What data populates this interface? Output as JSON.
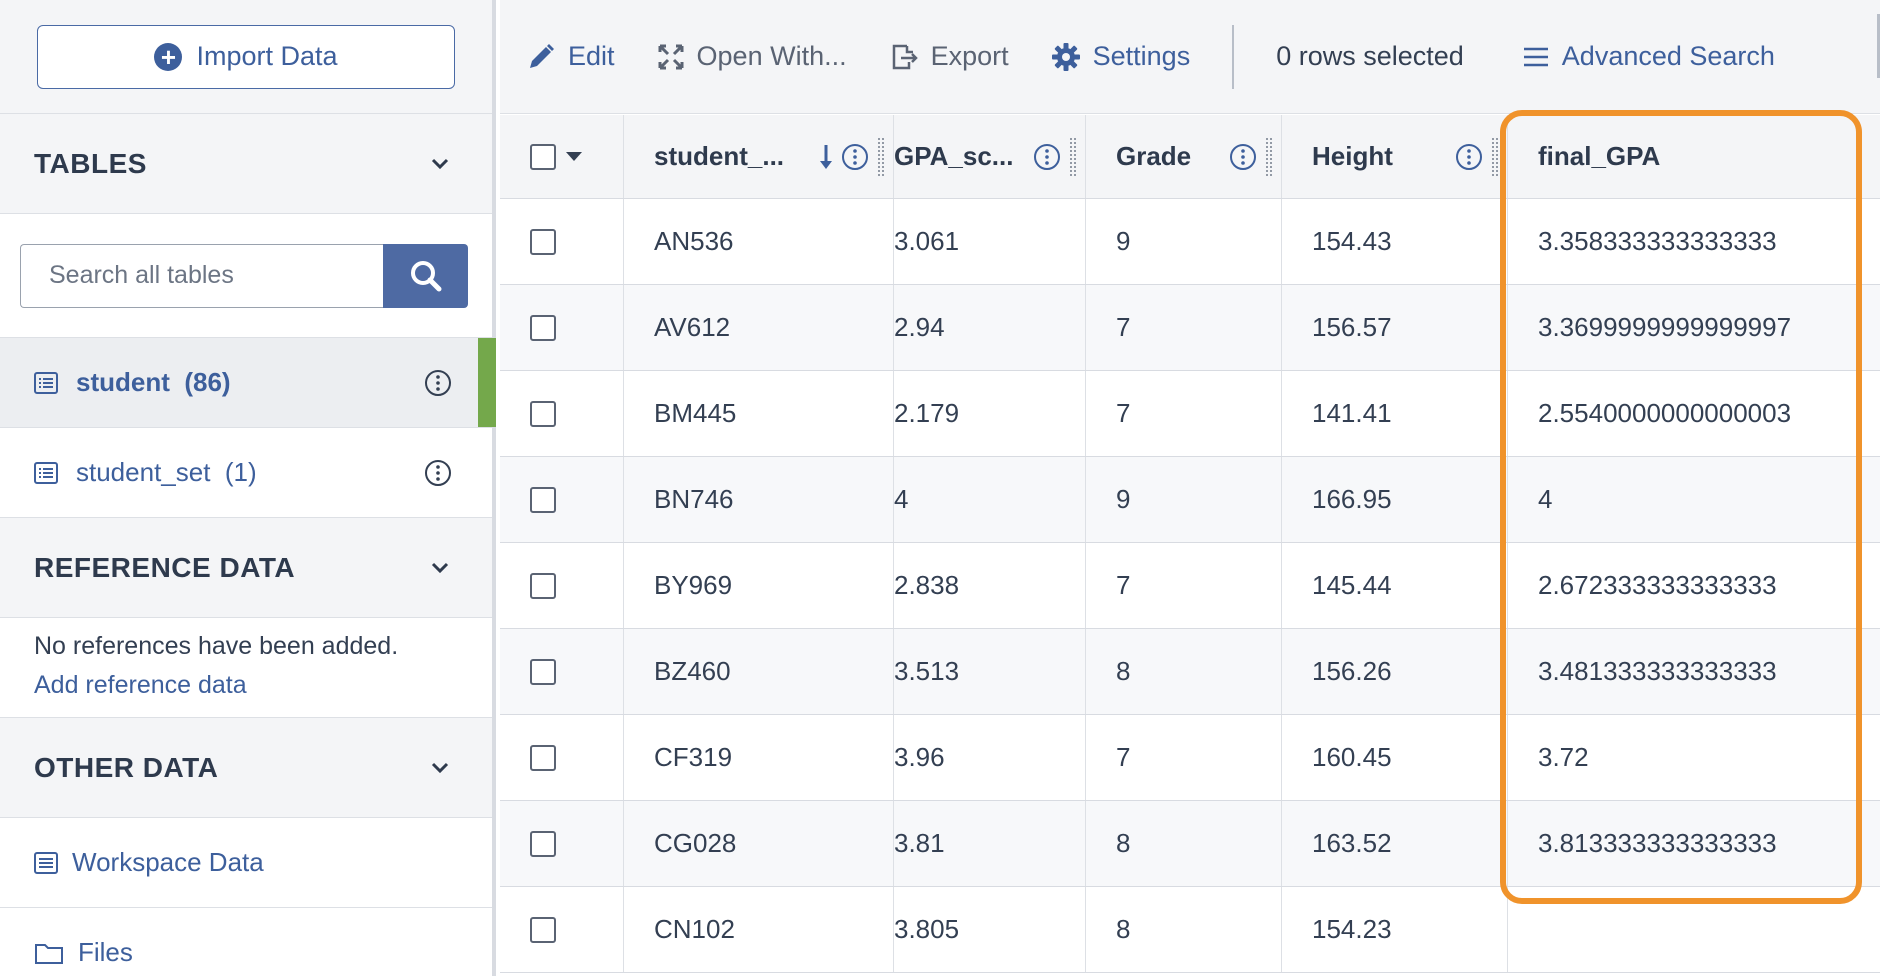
{
  "sidebar": {
    "import_label": "Import Data",
    "tables_title": "TABLES",
    "search_placeholder": "Search all tables",
    "tables": [
      {
        "name": "student",
        "count": "(86)"
      },
      {
        "name": "student_set",
        "count": "(1)"
      }
    ],
    "reference_title": "REFERENCE DATA",
    "reference_empty": "No references have been added.",
    "reference_add": "Add reference data",
    "other_title": "OTHER DATA",
    "other_items": [
      "Workspace Data",
      "Files"
    ]
  },
  "toolbar": {
    "edit": "Edit",
    "open_with": "Open With...",
    "export": "Export",
    "settings": "Settings",
    "rows_selected": "0 rows selected",
    "advanced_search": "Advanced Search"
  },
  "grid": {
    "columns": [
      "student_...",
      "GPA_sc...",
      "Grade",
      "Height",
      "final_GPA"
    ],
    "rows": [
      [
        "AN536",
        "3.061",
        "9",
        "154.43",
        "3.358333333333333"
      ],
      [
        "AV612",
        "2.94",
        "7",
        "156.57",
        "3.3699999999999997"
      ],
      [
        "BM445",
        "2.179",
        "7",
        "141.41",
        "2.5540000000000003"
      ],
      [
        "BN746",
        "4",
        "9",
        "166.95",
        "4"
      ],
      [
        "BY969",
        "2.838",
        "7",
        "145.44",
        "2.672333333333333"
      ],
      [
        "BZ460",
        "3.513",
        "8",
        "156.26",
        "3.481333333333333"
      ],
      [
        "CF319",
        "3.96",
        "7",
        "160.45",
        "3.72"
      ],
      [
        "CG028",
        "3.81",
        "8",
        "163.52",
        "3.813333333333333"
      ],
      [
        "CN102",
        "3.805",
        "8",
        "154.23",
        ""
      ]
    ]
  },
  "colors": {
    "accent": "#3d5f9c",
    "highlight": "#f0932b",
    "active_marker": "#74a84b"
  }
}
